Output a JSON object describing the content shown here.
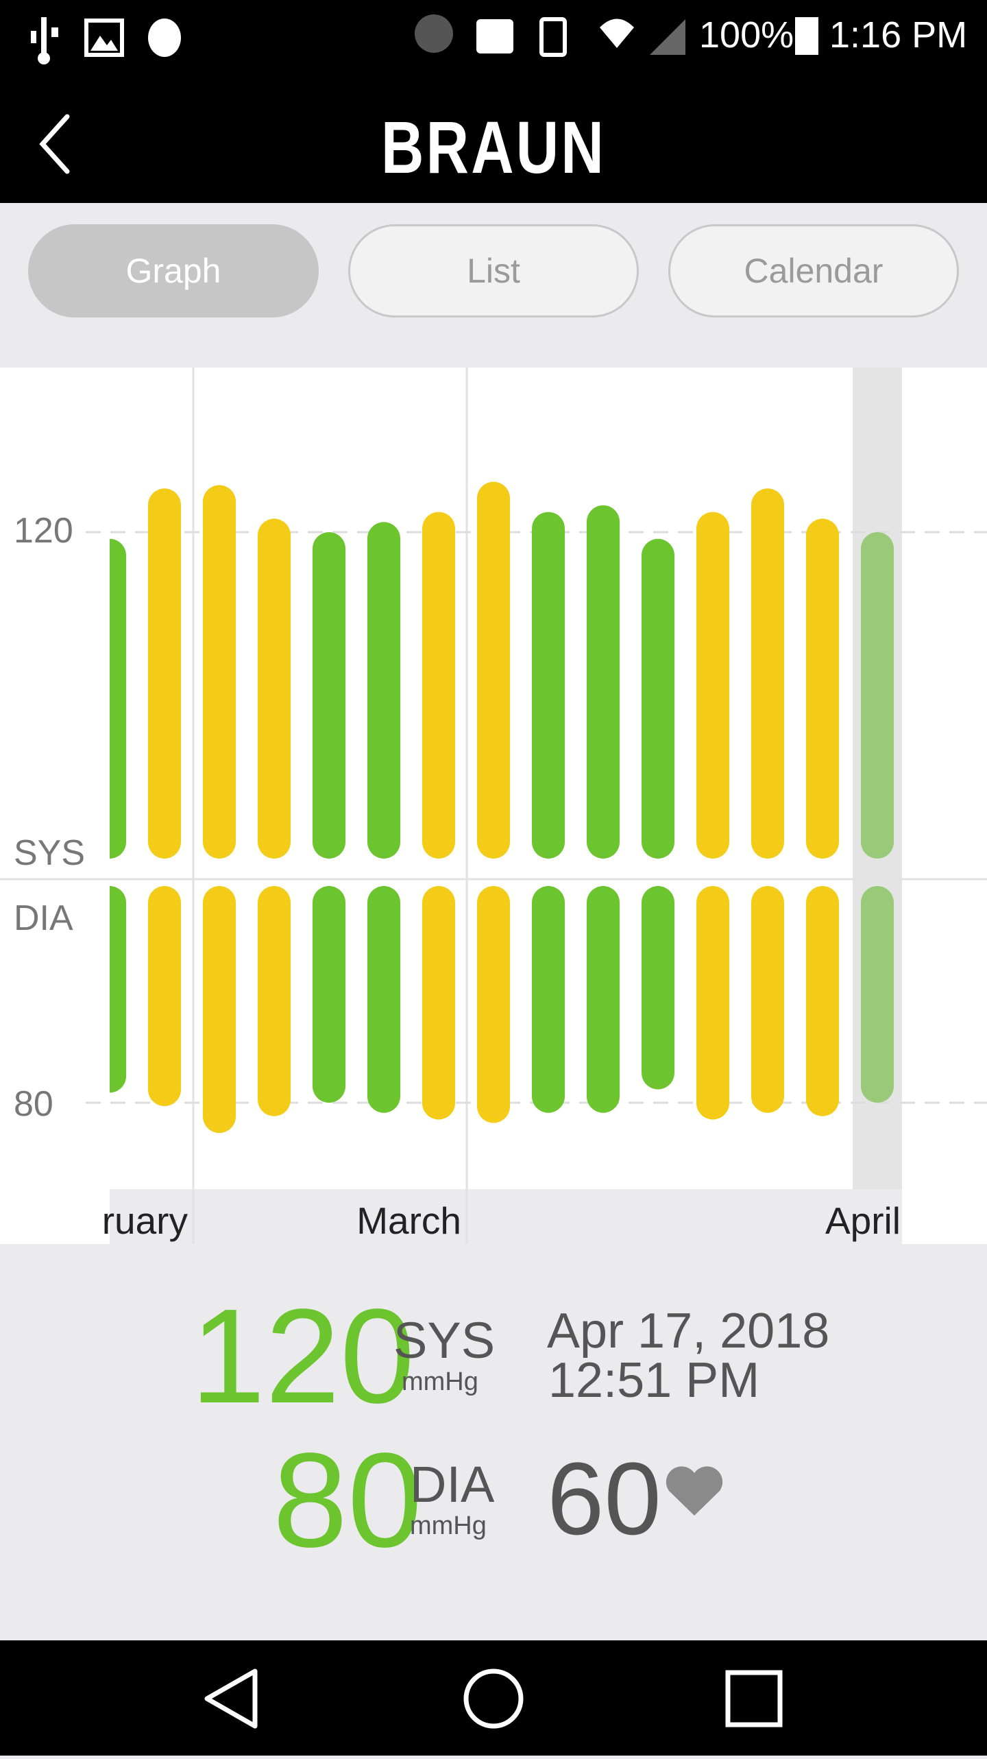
{
  "status_bar": {
    "battery": "100%",
    "time": "1:16 PM",
    "icons": [
      "usb-icon",
      "image-icon",
      "debug-icon",
      "bluetooth-icon",
      "nfc-icon",
      "vibrate-icon",
      "wifi-icon",
      "signal-icon",
      "battery-charging-icon"
    ]
  },
  "header": {
    "logo": "BRAUN",
    "back_icon": "chevron-left-icon"
  },
  "tabs": [
    {
      "label": "Graph",
      "active": true
    },
    {
      "label": "List"
    },
    {
      "label": "Calendar"
    }
  ],
  "chart_data": {
    "type": "bar",
    "y_labels": {
      "sys_ref": "120",
      "dia_ref": "80",
      "sys": "SYS",
      "dia": "DIA"
    },
    "month_labels": [
      "ruary",
      "March",
      "April"
    ],
    "sys": [
      118,
      133,
      134,
      124,
      120,
      123,
      126,
      135,
      126,
      128,
      118,
      126,
      133,
      124,
      120
    ],
    "dia": [
      77,
      81,
      89,
      84,
      80,
      83,
      85,
      86,
      83,
      83,
      76,
      85,
      83,
      84,
      80
    ],
    "status": [
      "normal",
      "elevated",
      "elevated",
      "elevated",
      "normal",
      "normal",
      "elevated",
      "elevated",
      "normal",
      "normal",
      "normal",
      "elevated",
      "elevated",
      "elevated",
      "normal"
    ],
    "selected_index": 14,
    "colors": {
      "normal": "#6cc42e",
      "elevated": "#f4cc17",
      "selected": "#9bc97a"
    },
    "grid": true
  },
  "reading": {
    "sys": "120",
    "sys_label": "SYS",
    "dia": "80",
    "dia_label": "DIA",
    "unit": "mmHg",
    "date": "Apr 17, 2018",
    "time": "12:51 PM",
    "pulse": "60",
    "accent": "#6cc42e"
  }
}
